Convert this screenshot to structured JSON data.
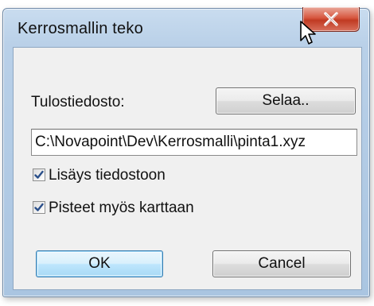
{
  "window": {
    "title": "Kerrosmallin teko",
    "close_icon": "close-x-icon"
  },
  "output": {
    "label": "Tulostiedosto:",
    "browse_label": "Selaa..",
    "path_value": "C:\\Novapoint\\Dev\\Kerrosmalli\\pinta1.xyz"
  },
  "options": {
    "append_label": "Lisäys tiedostoon",
    "append_checked": true,
    "points_to_map_label": "Pisteet myös karttaan",
    "points_to_map_checked": true
  },
  "actions": {
    "ok_label": "OK",
    "cancel_label": "Cancel"
  },
  "colors": {
    "titlebar": "#b9d0e8",
    "close_button": "#c03a22",
    "default_button_border": "#3c7fb1",
    "check_mark": "#2a4f8a"
  }
}
